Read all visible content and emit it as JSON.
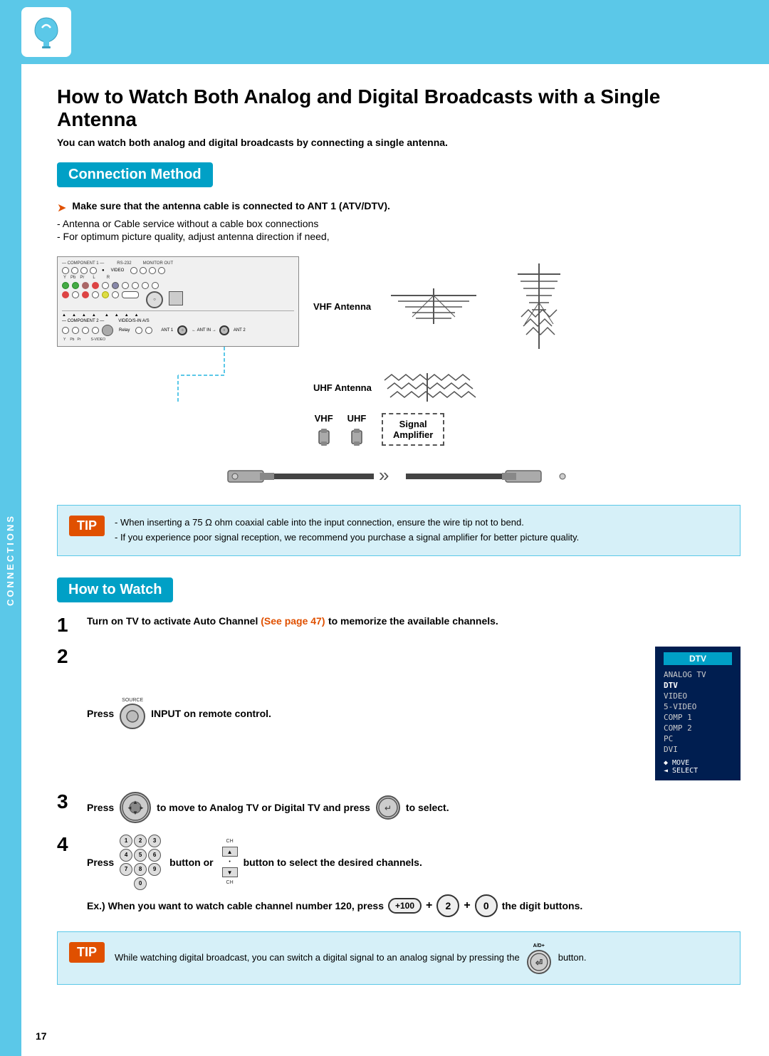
{
  "topbar": {
    "logo_symbol": "⌐"
  },
  "sidebar": {
    "label": "CONNECTIONS"
  },
  "page": {
    "title": "How to Watch Both Analog and Digital Broadcasts with a Single Antenna",
    "subtitle": "You can watch both analog and digital broadcasts by connecting a single antenna.",
    "page_number": "17"
  },
  "connection_method": {
    "header": "Connection Method",
    "bullets": [
      "Make sure that the antenna cable is connected to ANT 1 (ATV/DTV).",
      "- Antenna or Cable service without a cable box connections",
      "- For optimum picture quality, adjust antenna direction if need,"
    ],
    "vhf_label": "VHF Antenna",
    "uhf_label": "UHF Antenna",
    "vhf_short": "VHF",
    "uhf_short": "UHF",
    "signal_amplifier": "Signal\nAmplifier"
  },
  "tip1": {
    "label": "TIP",
    "lines": [
      "- When inserting a 75 Ω  ohm coaxial cable into the input connection, ensure the wire tip not to bend.",
      "- If you experience poor signal reception, we recommend you purchase a signal amplifier for better picture quality."
    ]
  },
  "how_to_watch": {
    "header": "How to Watch",
    "steps": [
      {
        "num": "1",
        "text": "Turn on TV to activate Auto Channel",
        "link": "(See page 47)",
        "text2": "to memorize the available channels."
      },
      {
        "num": "2",
        "label_source": "SOURCE",
        "text": "INPUT on remote control."
      },
      {
        "num": "3",
        "text1": "Press",
        "text2": "to move to Analog TV or Digital TV and press",
        "text3": "to select."
      },
      {
        "num": "4",
        "text1": "Press",
        "text2": "button or",
        "text3": "button to select the desired channels."
      }
    ],
    "example_text": "Ex.) When you want to watch cable channel number 120, press",
    "example_text2": "the digit buttons.",
    "example_plus100": "+100",
    "example_2": "2",
    "example_0": "0",
    "dtv_menu": {
      "title": "DTV",
      "items": [
        "ANALOG TV",
        "DTV",
        "VIDEO",
        "5-VIDEO",
        "COMP 1",
        "COMP 2",
        "PC",
        "DVI"
      ],
      "selected": "DTV",
      "footer": "◆ MOVE\n◄ SELECT"
    }
  },
  "tip2": {
    "label": "TIP",
    "text": "While watching digital broadcast, you can switch a digital signal to an analog signal by pressing the",
    "button_label": "A/D+",
    "text2": "button."
  }
}
